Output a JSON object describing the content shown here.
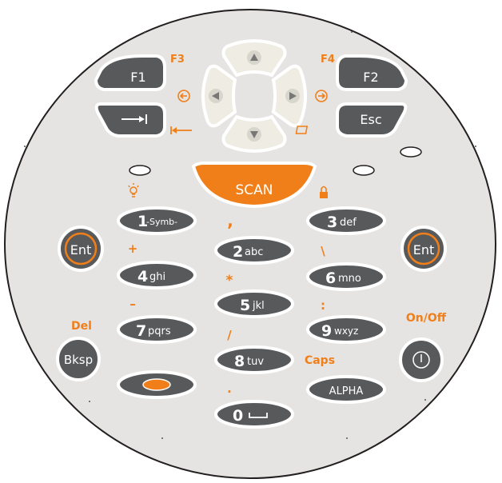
{
  "colors": {
    "face": "#e6e4e2",
    "edge": "#231f20",
    "key_dark": "#58595b",
    "key_light": "#efece4",
    "accent": "#f07f1a",
    "white": "#ffffff"
  },
  "keys": {
    "f1": "F1",
    "f2": "F2",
    "esc": "Esc",
    "scan": "SCAN",
    "ent_left": "Ent",
    "ent_right": "Ent",
    "bksp": "Bksp",
    "alpha": "ALPHA",
    "k1_digit": "1",
    "k1_letters": "-Symb-",
    "k2_digit": "2",
    "k2_letters": "abc",
    "k3_digit": "3",
    "k3_letters": "def",
    "k4_digit": "4",
    "k4_letters": "ghi",
    "k5_digit": "5",
    "k5_letters": "jkl",
    "k6_digit": "6",
    "k6_letters": "mno",
    "k7_digit": "7",
    "k7_letters": "pqrs",
    "k8_digit": "8",
    "k8_letters": "tuv",
    "k9_digit": "9",
    "k9_letters": "wxyz",
    "k0_digit": "0"
  },
  "labels": {
    "f3": "F3",
    "f4": "F4",
    "del": "Del",
    "caps": "Caps",
    "on_off": "On/Off",
    "comma": ",",
    "plus": "+",
    "star": "*",
    "minus": "–",
    "slash": "/",
    "dot": ".",
    "backslash": "\\",
    "colon": ":"
  },
  "icons": [
    "arrow-up-icon",
    "arrow-down-icon",
    "arrow-left-icon",
    "arrow-right-icon",
    "tab-icon",
    "back-tab-icon",
    "circle-left-icon",
    "circle-right-icon",
    "bulb-icon",
    "lock-icon",
    "window-icon",
    "space-icon",
    "power-icon",
    "oval-icon"
  ]
}
